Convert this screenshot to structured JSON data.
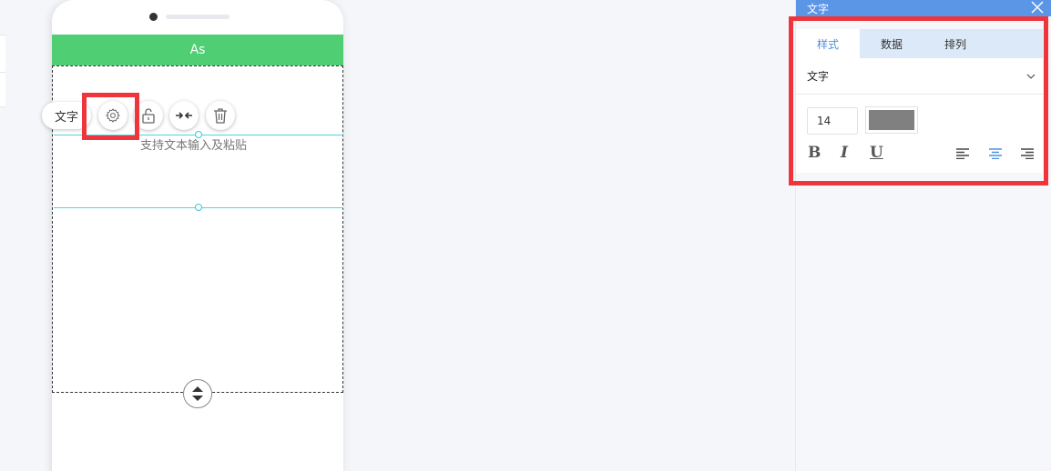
{
  "phone": {
    "header_title": "As",
    "text_placeholder": "支持文本输入及粘贴"
  },
  "toolbar": {
    "component_label": "文字",
    "buttons": [
      "gear-icon",
      "unlock-icon",
      "merge-icon",
      "trash-icon"
    ]
  },
  "panel": {
    "title": "文字",
    "tabs": [
      {
        "label": "样式",
        "active": true
      },
      {
        "label": "数据",
        "active": false
      },
      {
        "label": "排列",
        "active": false
      }
    ],
    "component_select": "文字",
    "font_size": "14",
    "text_color": "#808080",
    "format_buttons": [
      "B",
      "I",
      "U"
    ],
    "align_active": "center"
  },
  "colors": {
    "header_green": "#4fce73",
    "panel_title_blue": "#5b95e5",
    "highlight_red": "#f0343c",
    "guide_cyan": "#4bd6dc"
  }
}
